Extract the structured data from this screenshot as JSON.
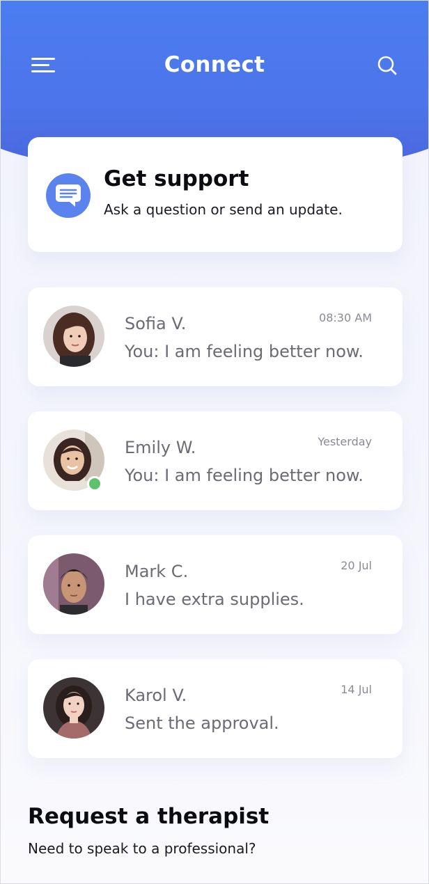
{
  "header": {
    "title": "Connect",
    "menu_icon": "hamburger-menu-icon",
    "search_icon": "search-icon"
  },
  "support": {
    "title": "Get support",
    "subtitle": "Ask a question or send an update.",
    "icon": "chat-bubble-icon"
  },
  "chats": [
    {
      "name": "Sofia V.",
      "message": "You: I am feeling better now.",
      "time": "08:30 AM",
      "online": false
    },
    {
      "name": "Emily W.",
      "message": "You: I am feeling better now.",
      "time": "Yesterday",
      "online": true
    },
    {
      "name": "Mark C.",
      "message": "I have extra supplies.",
      "time": "20 Jul",
      "online": false
    },
    {
      "name": "Karol V.",
      "message": "Sent the approval.",
      "time": "14 Jul",
      "online": false
    }
  ],
  "request": {
    "title": "Request a therapist",
    "subtitle": "Need to speak to a professional?"
  },
  "colors": {
    "header_blue": "#4d74ea",
    "icon_blue": "#5b83ee",
    "online_green": "#5cc36a",
    "muted_text": "#6b6b76"
  }
}
